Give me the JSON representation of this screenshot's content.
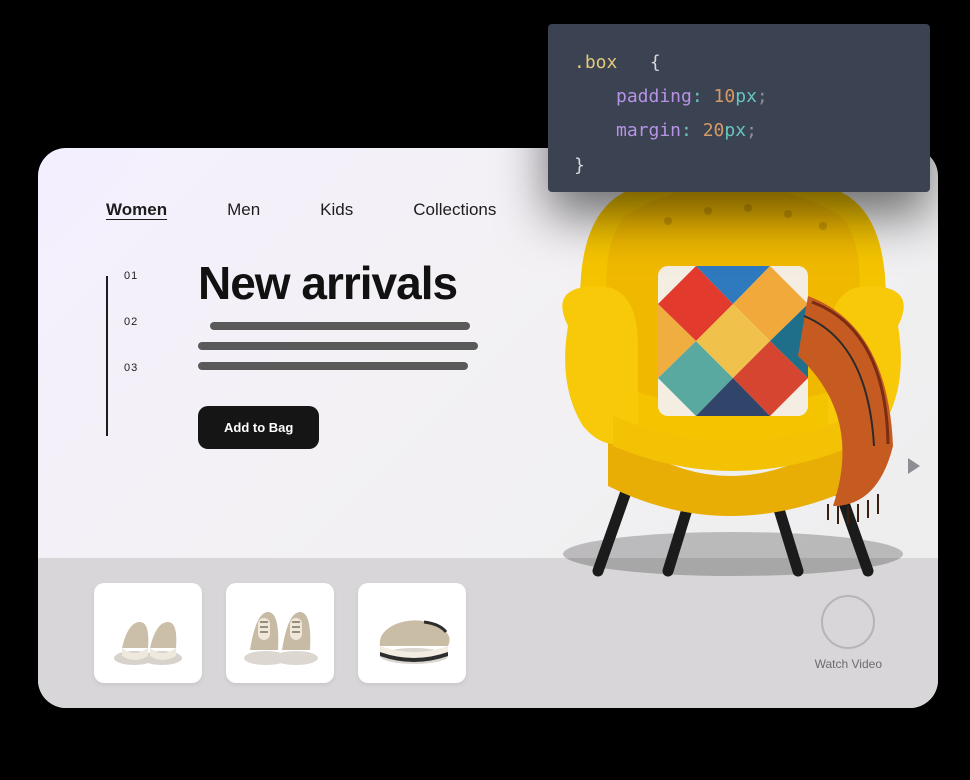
{
  "nav": {
    "items": [
      {
        "label": "Women",
        "active": true
      },
      {
        "label": "Men"
      },
      {
        "label": "Kids"
      },
      {
        "label": "Collections"
      }
    ]
  },
  "hero": {
    "counters": [
      "01",
      "02",
      "03"
    ],
    "headline": "New arrivals",
    "cta_label": "Add to Bag"
  },
  "strip": {
    "watch_label": "Watch Video"
  },
  "code": {
    "selector": ".box",
    "open": "{",
    "close": "}",
    "rules": [
      {
        "prop": "padding",
        "value": "10",
        "unit": "px"
      },
      {
        "prop": "margin",
        "value": "20",
        "unit": "px"
      }
    ]
  }
}
